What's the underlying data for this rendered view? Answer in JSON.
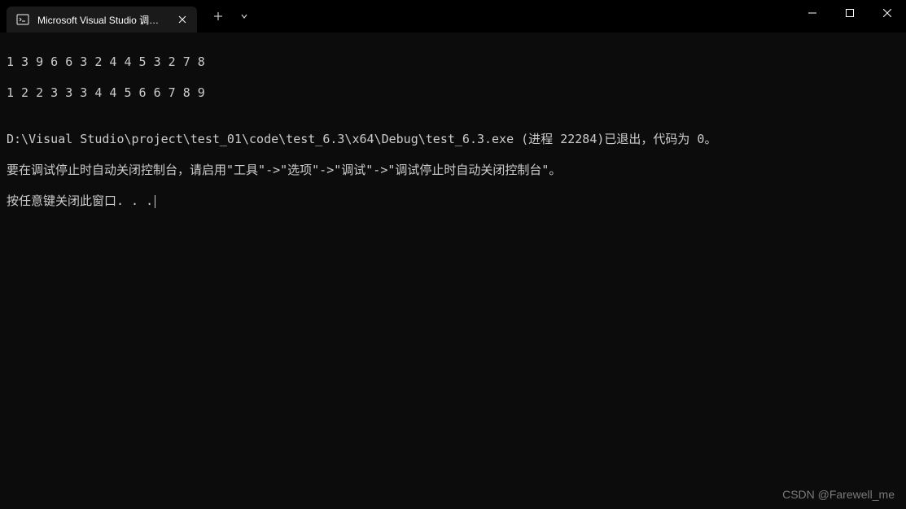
{
  "titlebar": {
    "tab_title": "Microsoft Visual Studio 调试控",
    "new_tab_tooltip": "+",
    "dropdown_tooltip": "⌄"
  },
  "console": {
    "line1": "1 3 9 6 6 3 2 4 4 5 3 2 7 8",
    "line2": "1 2 2 3 3 3 4 4 5 6 6 7 8 9",
    "blank": "",
    "exit_line": "D:\\Visual Studio\\project\\test_01\\code\\test_6.3\\x64\\Debug\\test_6.3.exe (进程 22284)已退出，代码为 0。",
    "hint_line": "要在调试停止时自动关闭控制台，请启用\"工具\"->\"选项\"->\"调试\"->\"调试停止时自动关闭控制台\"。",
    "press_key_line": "按任意键关闭此窗口. . ."
  },
  "watermark": "CSDN @Farewell_me"
}
